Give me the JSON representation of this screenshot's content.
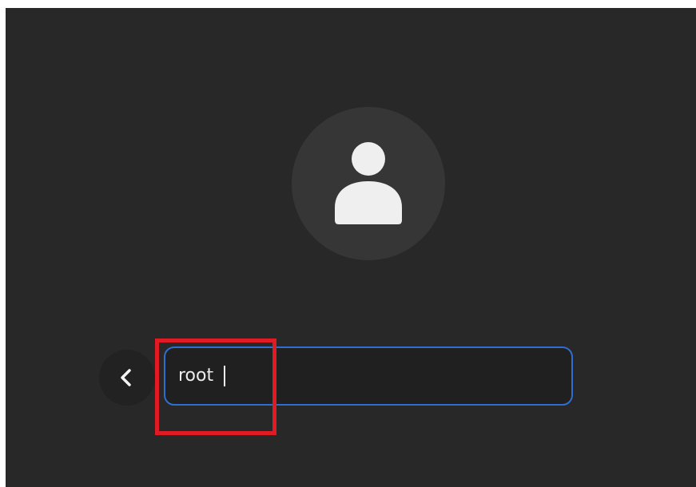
{
  "screen": {
    "background": "#282828"
  },
  "avatar": {
    "icon": "user-silhouette-icon",
    "circle_color": "#363636",
    "icon_color": "#efefef"
  },
  "login": {
    "back_icon": "chevron-left-icon",
    "username_value": "root",
    "focus_color": "#2f6ecf"
  },
  "annotation": {
    "highlight_color": "#e01b24"
  }
}
